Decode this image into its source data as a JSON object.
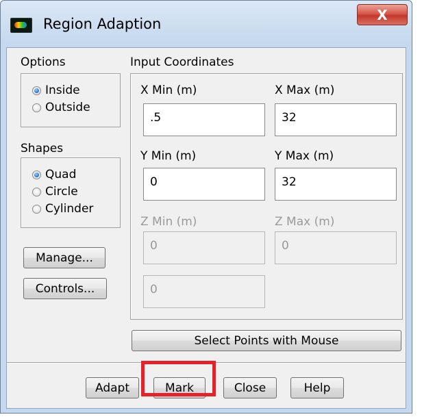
{
  "window": {
    "title": "Region Adaption",
    "close_symbol": "X",
    "app_icon": "fluent-app-icon"
  },
  "options": {
    "label": "Options",
    "items": [
      {
        "label": "Inside",
        "selected": true
      },
      {
        "label": "Outside",
        "selected": false
      }
    ]
  },
  "shapes": {
    "label": "Shapes",
    "items": [
      {
        "label": "Quad",
        "selected": true
      },
      {
        "label": "Circle",
        "selected": false
      },
      {
        "label": "Cylinder",
        "selected": false
      }
    ]
  },
  "side_buttons": {
    "manage": "Manage...",
    "controls": "Controls..."
  },
  "coords": {
    "label": "Input Coordinates",
    "x_min": {
      "label": "X Min (m)",
      "value": ".5",
      "enabled": true
    },
    "x_max": {
      "label": "X Max (m)",
      "value": "32",
      "enabled": true
    },
    "y_min": {
      "label": "Y Min (m)",
      "value": "0",
      "enabled": true
    },
    "y_max": {
      "label": "Y Max (m)",
      "value": "32",
      "enabled": true
    },
    "z_min": {
      "label": "Z Min (m)",
      "value": "0",
      "enabled": false
    },
    "z_max": {
      "label": "Z Max (m)",
      "value": "0",
      "enabled": false
    },
    "radius": {
      "value": "0",
      "enabled": false
    },
    "select_points": "Select Points with Mouse"
  },
  "footer": {
    "adapt": "Adapt",
    "mark": "Mark",
    "close": "Close",
    "help": "Help"
  },
  "highlight_color": "#e8202a"
}
